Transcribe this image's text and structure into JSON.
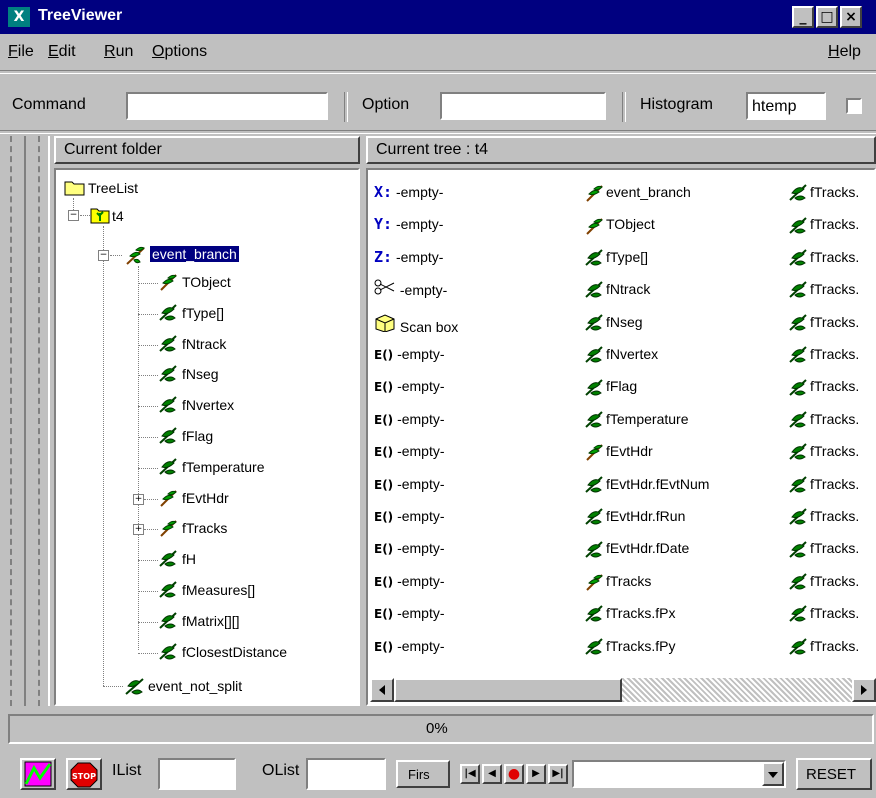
{
  "window": {
    "title": "TreeViewer",
    "icon": "X"
  },
  "menu": {
    "file": "File",
    "edit": "Edit",
    "run": "Run",
    "options": "Options",
    "help": "Help"
  },
  "toolbar": {
    "command_label": "Command",
    "command_value": "",
    "option_label": "Option",
    "option_value": "",
    "histogram_label": "Histogram",
    "histogram_value": "htemp"
  },
  "left_panel": {
    "header": "Current folder",
    "root": "TreeList",
    "tree": "t4",
    "branch": "event_branch",
    "children": [
      "TObject",
      "fType[]",
      "fNtrack",
      "fNseg",
      "fNvertex",
      "fFlag",
      "fTemperature",
      "fEvtHdr",
      "fTracks",
      "fH",
      "fMeasures[]",
      "fMatrix[][]",
      "fClosestDistance"
    ],
    "after": "event_not_split"
  },
  "right_panel": {
    "header": "Current tree : t4",
    "col1": [
      {
        "prefix": "X:",
        "text": "-empty-"
      },
      {
        "prefix": "Y:",
        "text": "-empty-"
      },
      {
        "prefix": "Z:",
        "text": "-empty-"
      },
      {
        "prefix": "cut",
        "text": "-empty-"
      },
      {
        "prefix": "box",
        "text": "Scan box"
      },
      {
        "prefix": "E()",
        "text": "-empty-"
      },
      {
        "prefix": "E()",
        "text": "-empty-"
      },
      {
        "prefix": "E()",
        "text": "-empty-"
      },
      {
        "prefix": "E()",
        "text": "-empty-"
      },
      {
        "prefix": "E()",
        "text": "-empty-"
      },
      {
        "prefix": "E()",
        "text": "-empty-"
      },
      {
        "prefix": "E()",
        "text": "-empty-"
      },
      {
        "prefix": "E()",
        "text": "-empty-"
      },
      {
        "prefix": "E()",
        "text": "-empty-"
      },
      {
        "prefix": "E()",
        "text": "-empty-"
      }
    ],
    "col2": [
      "event_branch",
      "TObject",
      "fType[]",
      "fNtrack",
      "fNseg",
      "fNvertex",
      "fFlag",
      "fTemperature",
      "fEvtHdr",
      "fEvtHdr.fEvtNum",
      "fEvtHdr.fRun",
      "fEvtHdr.fDate",
      "fTracks",
      "fTracks.fPx",
      "fTracks.fPy"
    ],
    "col3": [
      "fTracks.",
      "fTracks.",
      "fTracks.",
      "fTracks.",
      "fTracks.",
      "fTracks.",
      "fTracks.",
      "fTracks.",
      "fTracks.",
      "fTracks.",
      "fTracks.",
      "fTracks.",
      "fTracks.",
      "fTracks.",
      "fTracks."
    ]
  },
  "progress": {
    "text": "0%"
  },
  "bottom": {
    "ilist_label": "IList",
    "olist_label": "OList",
    "first_label": "Firs",
    "reset_label": "RESET"
  }
}
